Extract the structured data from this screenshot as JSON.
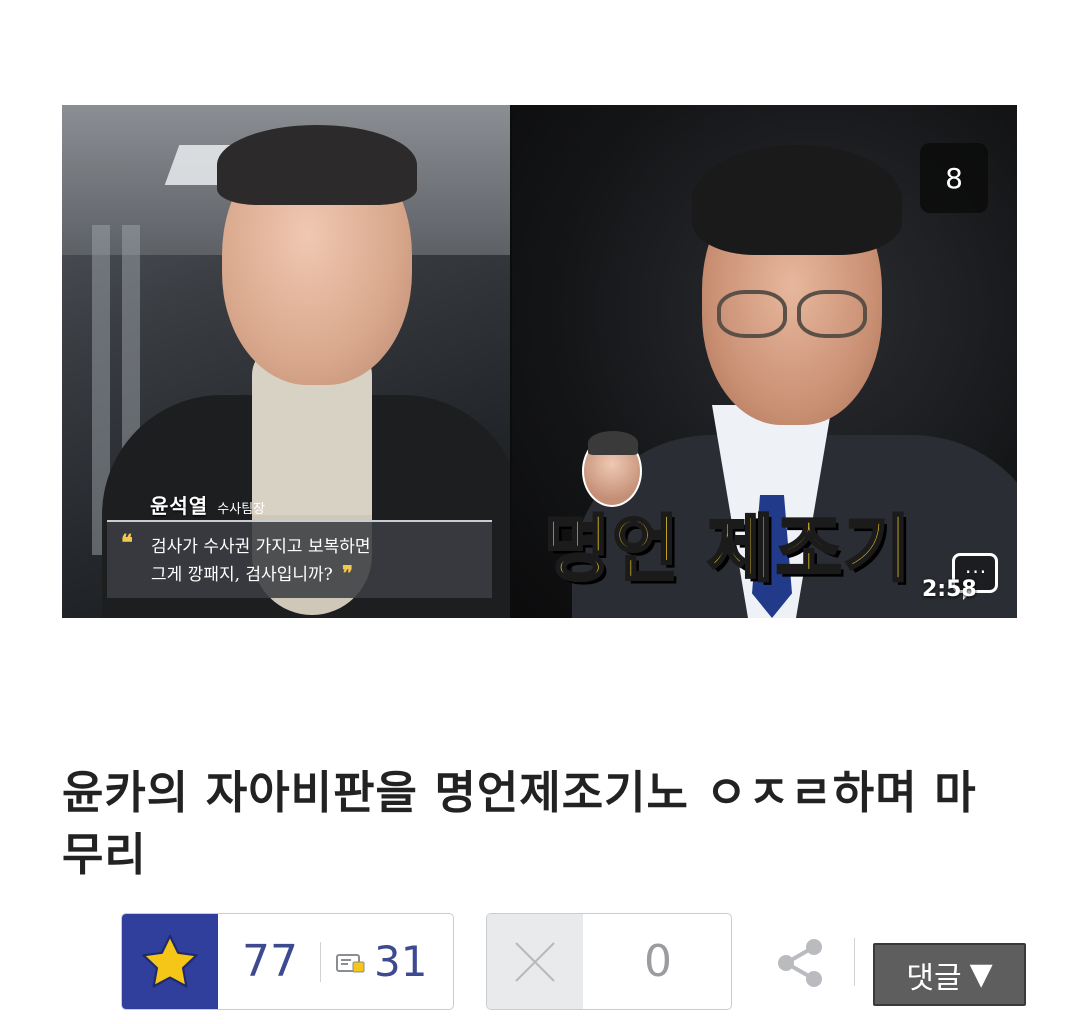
{
  "thumbnail": {
    "left_person_name": "윤석열",
    "left_person_role": "수사팀장",
    "quote_line1": "검사가 수사권 가지고 보복하면",
    "quote_line2": "그게 깡패지, 검사입니까?",
    "quote_open": "❝",
    "quote_close": "❞",
    "headline": "명언 제조기",
    "image_count": "8",
    "duration": "2:58",
    "comment_icon_glyph": "···",
    "headline_color": "#f7d22a"
  },
  "post": {
    "title": "윤카의 자아비판을 명언제조기노 ㅇㅈㄹ하며 마무리"
  },
  "actions": {
    "upvote_count": "77",
    "bookmark_count": "31",
    "downvote_count": "0",
    "comment_button_label": "댓글",
    "comment_button_arrow": "▼",
    "accent_color": "#2f3f9b",
    "star_color": "#f5c518"
  },
  "icons": {
    "upvote": "star-icon",
    "bookmark": "bookmark-card-icon",
    "downvote": "x-icon",
    "share": "share-icon",
    "comment_overlay": "speech-bubble-icon"
  }
}
